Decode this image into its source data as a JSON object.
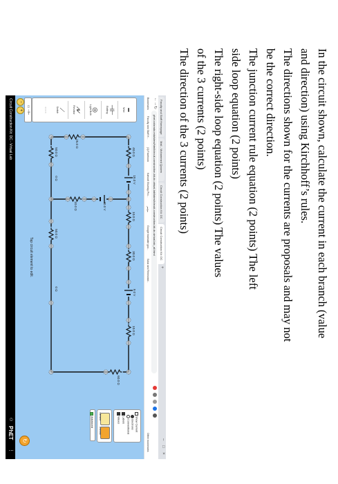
{
  "browser": {
    "tabs": [
      {
        "label": "Faculty and Staff Homepage"
      },
      {
        "label": "Mail - Mohammed Qasem"
      },
      {
        "label": "Circuit Construction Kit: DC"
      },
      {
        "label": "Circuit Construction Kit: DC"
      }
    ],
    "new_tab": "+",
    "url": "phet.colorado.edu/sims/html/circuit-construction-kit-dc-virtual-lab/latest/circuit-construction-kit-dc-virtual-lab_all.html",
    "bookmarks": [
      "Bookmarks",
      "Faculty and Staff H...",
      "(1) Facebook",
      "Kahoot! Bluesky Pro...",
      "مؤتمر",
      "Google translate goo...",
      "Solar and Renewabl...",
      "Other bookmarks"
    ]
  },
  "toolbox": {
    "items": [
      {
        "label": "Wire",
        "icon": "wire-icon"
      },
      {
        "label": "Battery",
        "icon": "battery-icon"
      },
      {
        "label": "Light Bulb",
        "icon": "light-bulb-icon"
      },
      {
        "label": "Resistor",
        "icon": "resistor-icon"
      },
      {
        "label": "Switch",
        "icon": "switch-icon"
      }
    ]
  },
  "options": {
    "show_current": "Show Current",
    "electrons": "Electrons",
    "conventional": "Conventional",
    "labels": "Labels",
    "values": "Values"
  },
  "sensors": {
    "voltmeter": "Voltmeter",
    "ammeter": "Ammeter"
  },
  "advanced": "Advanced",
  "hint": "Tap circuit element to edit.",
  "circuit": {
    "resistors": [
      "40.0 Ω",
      "10.0 Ω",
      "30.0 Ω",
      "10.0 Ω",
      "60.0 Ω",
      "25.0 Ω",
      "50.0 Ω",
      "50.0 Ω",
      "10.0 Ω"
    ],
    "batteries": [
      "18.0 V",
      "40.0 V",
      "9.0 V"
    ],
    "wires": [
      "0 Ω",
      "0 Ω"
    ]
  },
  "navbar": {
    "title": "Circuit Construction Kit: DC - Virtual Lab",
    "logo": "PhET"
  },
  "question": {
    "lines": [
      "In the circuit shown, calculate the current in each branch (value",
      "and direction) using Kirchhoff’s rules.",
      "The directions shown for the currents are proposals and may not",
      "be the correct direction.",
      "The junction current rule equation (2 points)         The left",
      "side loop equation (2 points)",
      "The right-side loop equation (2 points)                The values",
      "of the 3 currents (2 points)",
      "The direction of the 3 currents (2 points)"
    ]
  },
  "colors": {
    "canvas": "#9bcaf2",
    "navbar": "#000000",
    "reset": "#f2a42e"
  }
}
